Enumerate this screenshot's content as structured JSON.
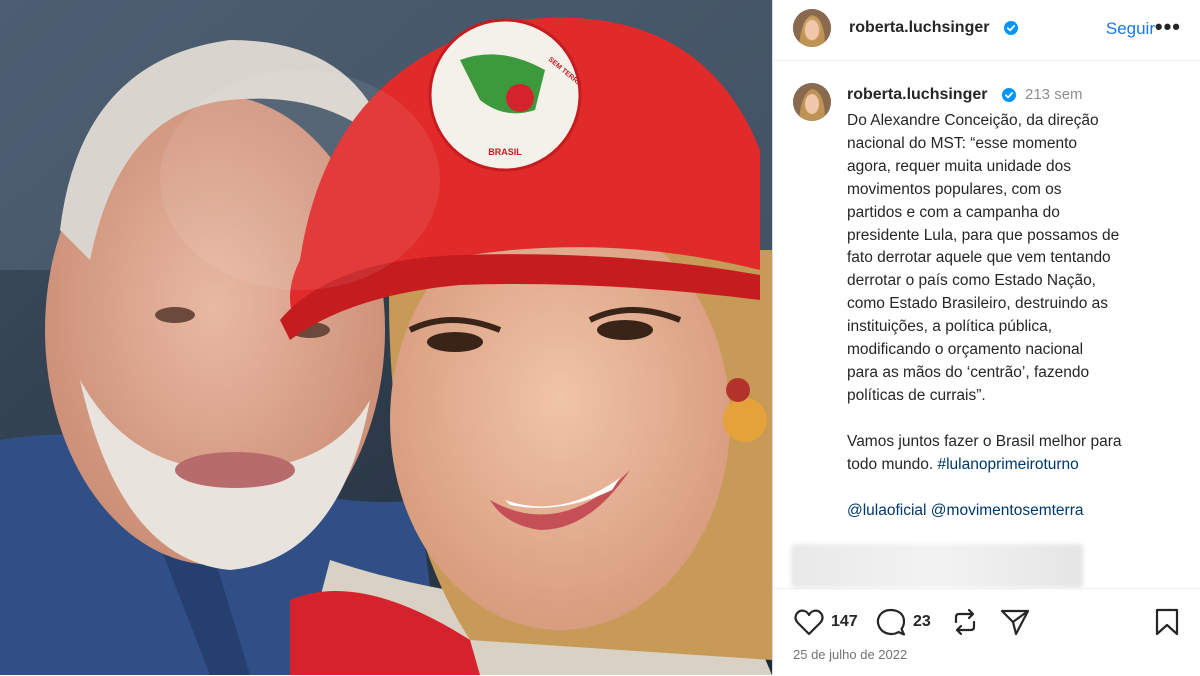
{
  "post": {
    "username": "roberta.luchsinger",
    "follow_label": "Seguir",
    "more_label": "•••",
    "time_ago": "213 sem",
    "caption_lines": [
      "Do Alexandre Conceição, da direção",
      "nacional do MST: “esse momento",
      "agora, requer muita unidade dos",
      "movimentos populares, com os",
      "partidos e com a campanha do",
      "presidente Lula, para que possamos de",
      "fato derrotar aquele que vem tentando",
      "derrotar o país como Estado Nação,",
      "como Estado Brasileiro, destruindo as",
      "instituições, a política pública,",
      "modificando o orçamento nacional",
      "para as mãos do ‘centrão’, fazendo",
      "políticas de currais”."
    ],
    "closing_line_1": "Vamos juntos fazer o Brasil melhor para",
    "closing_line_2_text": "todo mundo. ",
    "hashtag": "#lulanoprimeiroturno",
    "mentions": "@lulaoficial @movimentosemterra",
    "likes": "147",
    "comments": "23",
    "date": "25 de julho de 2022",
    "cap_badge_top": "SEM TERRA",
    "cap_badge_bottom": "BRASIL",
    "verified_color": "#0095f6",
    "accent_link": "#00376b",
    "follow_color": "#1877f2"
  }
}
